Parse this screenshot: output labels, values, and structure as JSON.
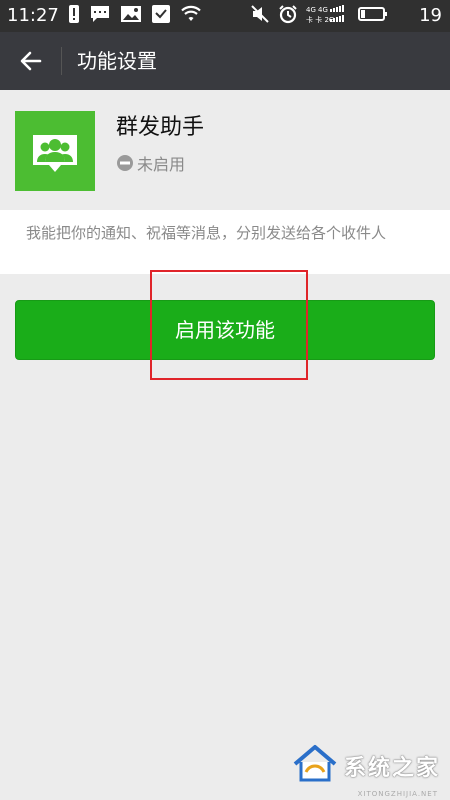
{
  "status_bar": {
    "time": "11:27",
    "battery_level": "19",
    "network_labels": "4G 4G"
  },
  "app_bar": {
    "title": "功能设置"
  },
  "feature": {
    "name": "群发助手",
    "status": "未启用",
    "description": "我能把你的通知、祝福等消息，分别发送给各个收件人",
    "icon_color": "#4cbd32"
  },
  "actions": {
    "enable_label": "启用该功能",
    "button_color": "#1aad19"
  },
  "annotation": {
    "highlight_color": "#e0242a"
  },
  "watermark": {
    "text": "系统之家",
    "sub": "XITONGZHIJIA.NET"
  }
}
